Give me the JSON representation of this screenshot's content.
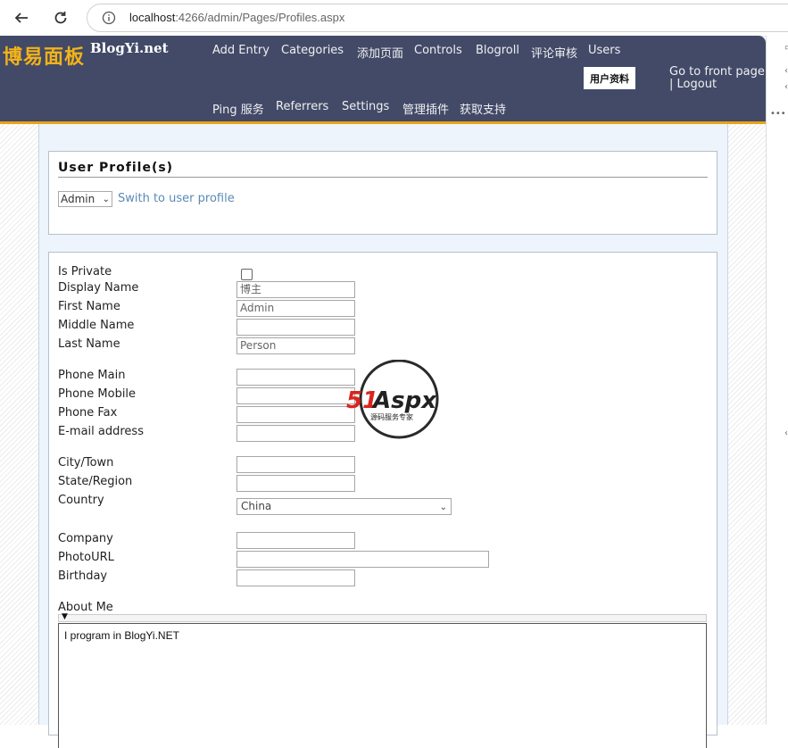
{
  "browser": {
    "url_host": "localhost",
    "url_rest": ":4266/admin/Pages/Profiles.aspx"
  },
  "header": {
    "logo_cn": "博易面板",
    "logo_en": "BlogYi.net",
    "menu_row1": [
      "Add Entry",
      "Categories",
      "添加页面",
      "Controls",
      "Blogroll",
      "评论审核",
      "Users"
    ],
    "active_item": "用户资料",
    "front_page": "Go to front page",
    "separator": "|",
    "logout": "Logout",
    "menu_row2": [
      "Ping 服务",
      "Referrers",
      "Settings",
      "管理插件",
      "获取支持"
    ]
  },
  "profile_panel": {
    "title": "User Profile(s)",
    "selected_user": "Admin",
    "switch_link": "Swith to user profile"
  },
  "form": {
    "is_private": "Is Private",
    "display_name": {
      "label": "Display Name",
      "value": "博主"
    },
    "first_name": {
      "label": "First Name",
      "value": "Admin"
    },
    "middle_name": {
      "label": "Middle Name",
      "value": ""
    },
    "last_name": {
      "label": "Last Name",
      "value": "Person"
    },
    "phone_main": {
      "label": "Phone Main",
      "value": ""
    },
    "phone_mobile": {
      "label": "Phone Mobile",
      "value": ""
    },
    "phone_fax": {
      "label": "Phone Fax",
      "value": ""
    },
    "email": {
      "label": "E-mail address",
      "value": ""
    },
    "city": {
      "label": "City/Town",
      "value": ""
    },
    "state": {
      "label": "State/Region",
      "value": ""
    },
    "country": {
      "label": "Country",
      "value": "China"
    },
    "company": {
      "label": "Company",
      "value": ""
    },
    "photo_url": {
      "label": "PhotoURL",
      "value": ""
    },
    "birthday": {
      "label": "Birthday",
      "value": ""
    },
    "about_me": {
      "label": "About Me",
      "value": "I program in BlogYi.NET"
    }
  },
  "watermark": {
    "brand_51": "51",
    "brand_aspx": "Aspx",
    "tagline": "源码服务专家"
  },
  "colors": {
    "header_bg": "#424a68",
    "header_accent": "#e8a317",
    "logo_cn": "#f2b319",
    "link": "#5a8ab5"
  }
}
